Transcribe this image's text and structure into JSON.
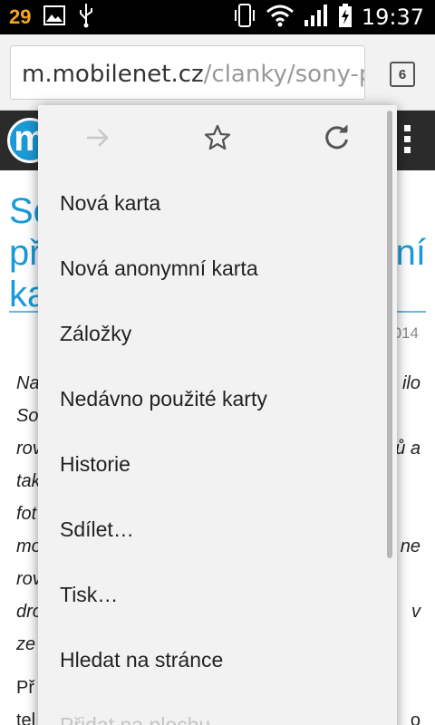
{
  "status_bar": {
    "notification_count": "29",
    "time": "19:37"
  },
  "address_bar": {
    "url_host": "m.mobilenet.cz",
    "url_path": "/clanky/sony-pre",
    "tab_count": "6"
  },
  "site": {
    "logo_letter": "m"
  },
  "article": {
    "title_lines": [
      {
        "left": "So",
        "right": ""
      },
      {
        "left": "př",
        "right": "ní"
      },
      {
        "left": "ka",
        "right": ""
      }
    ],
    "date": "014",
    "body_lines": [
      {
        "left": "Na",
        "right": "ilo"
      },
      {
        "left": "So",
        "right": ""
      },
      {
        "left": "rov",
        "right": "ů a"
      },
      {
        "left": "tak",
        "right": ""
      },
      {
        "left": "fot",
        "right": ""
      },
      {
        "left": "mo",
        "right": "ne"
      },
      {
        "left": "rov",
        "right": ""
      },
      {
        "left": "drc",
        "right": "v"
      },
      {
        "left": "ze",
        "right": ""
      }
    ],
    "p2_lines": [
      {
        "left": "Př",
        "right": ""
      },
      {
        "left": "tel",
        "right": "o"
      }
    ]
  },
  "menu": {
    "icons": [
      "forward-icon",
      "star-icon",
      "reload-icon"
    ],
    "items": [
      {
        "label": "Nová karta",
        "enabled": true
      },
      {
        "label": "Nová anonymní karta",
        "enabled": true
      },
      {
        "label": "Záložky",
        "enabled": true
      },
      {
        "label": "Nedávno použité karty",
        "enabled": true
      },
      {
        "label": "Historie",
        "enabled": true
      },
      {
        "label": "Sdílet…",
        "enabled": true
      },
      {
        "label": "Tisk…",
        "enabled": true
      },
      {
        "label": "Hledat na stránce",
        "enabled": true
      },
      {
        "label": "Přidat na plochu",
        "enabled": false
      }
    ]
  },
  "colors": {
    "accent": "#1a9ad6",
    "notification": "#f5a623",
    "menu_background": "#f2f2f2"
  }
}
